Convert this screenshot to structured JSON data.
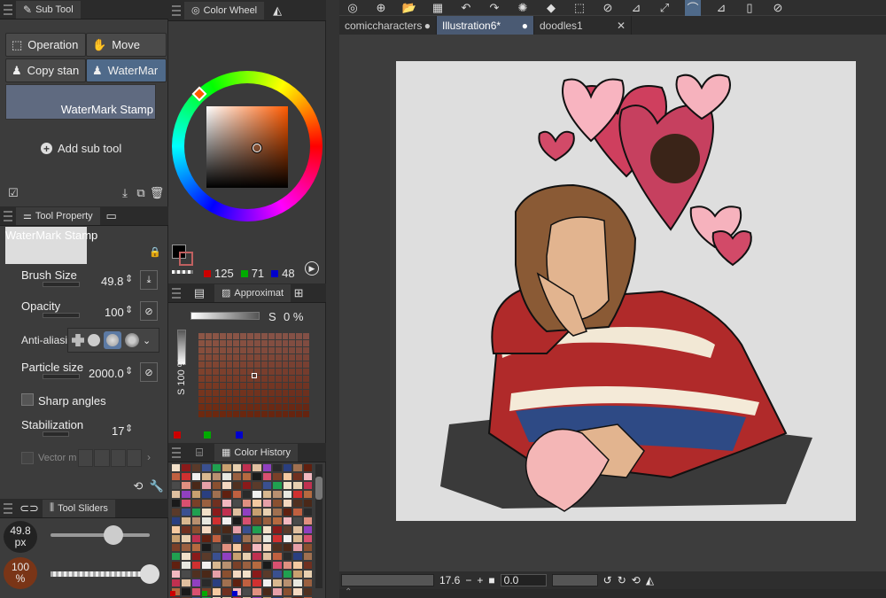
{
  "sub_tool": {
    "tab_label": "Sub Tool",
    "buttons": [
      "Operation",
      "Move",
      "Copy stan",
      "WaterMar"
    ],
    "selected_preset": "WaterMark Stamp",
    "add_sub_tool": "Add sub tool"
  },
  "tool_property": {
    "tab_label": "Tool Property",
    "tool_name": "WaterMark Stamp",
    "brush_size_label": "Brush Size",
    "brush_size_value": "49.8",
    "opacity_label": "Opacity",
    "opacity_value": "100",
    "anti_alias_label": "Anti-aliasin",
    "particle_size_label": "Particle size",
    "particle_size_value": "2000.0",
    "sharp_angles_label": "Sharp angles",
    "stabilization_label": "Stabilization",
    "stabilization_value": "17",
    "vector_label": "Vector m"
  },
  "tool_sliders": {
    "tab_label": "Tool Sliders",
    "size_value": "49.8",
    "size_unit": "px",
    "opacity_value": "100",
    "opacity_unit": "%",
    "size_fraction": 0.63,
    "opacity_fraction": 1.0
  },
  "color_wheel": {
    "tab_label": "Color Wheel",
    "r": "125",
    "g": "71",
    "b": "48",
    "main_color": "#7d4730"
  },
  "approx": {
    "tab_label": "Approximat",
    "s_label": "S",
    "s_value": "0 %",
    "v_label": "S 100 %"
  },
  "color_history": {
    "tab_label": "Color History"
  },
  "documents": {
    "tabs": [
      "comiccharacters",
      "Illustration6*",
      "doodles1"
    ],
    "active_index": 1
  },
  "navigator": {
    "zoom": "17.6",
    "angle": "0.0"
  }
}
